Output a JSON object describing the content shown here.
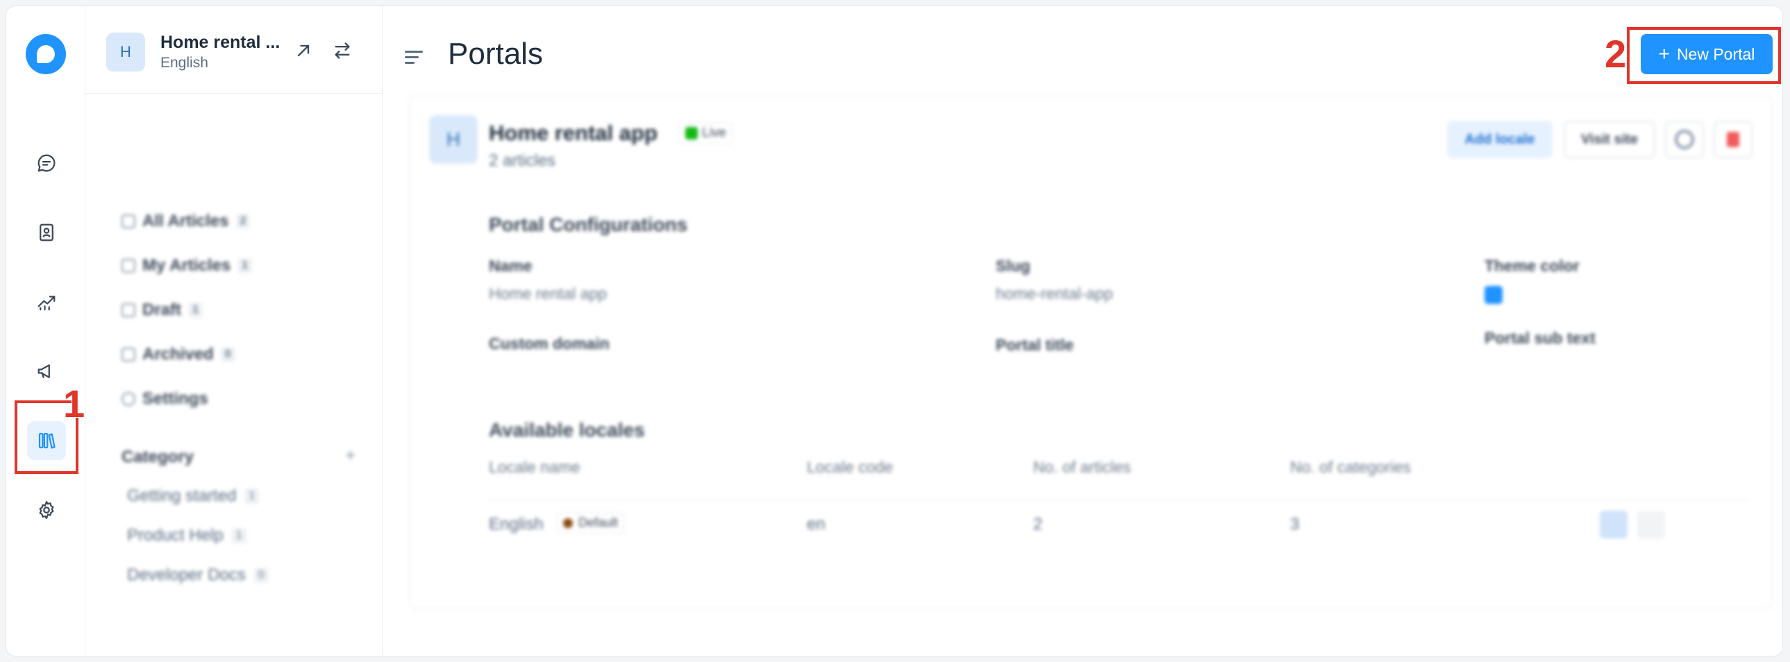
{
  "app": {
    "accent": "#1f93ff"
  },
  "rail": {
    "items": [
      {
        "name": "conversations",
        "icon": "chat-bubble-icon"
      },
      {
        "name": "contacts",
        "icon": "contact-card-icon"
      },
      {
        "name": "reports",
        "icon": "chart-line-icon"
      },
      {
        "name": "campaigns",
        "icon": "megaphone-icon"
      },
      {
        "name": "help-center",
        "icon": "library-books-icon",
        "active": true
      },
      {
        "name": "settings",
        "icon": "gear-icon"
      }
    ]
  },
  "portal": {
    "avatar": "H",
    "name": "Home rental ...",
    "locale": "English"
  },
  "sidebar": {
    "items": [
      {
        "label": "All Articles",
        "count": "2"
      },
      {
        "label": "My Articles",
        "count": "1"
      },
      {
        "label": "Draft",
        "count": "1"
      },
      {
        "label": "Archived",
        "count": "0"
      },
      {
        "label": "Settings"
      }
    ],
    "category_title": "Category",
    "category_add": "+",
    "categories": [
      {
        "label": "Getting started",
        "count": "1"
      },
      {
        "label": "Product Help",
        "count": "1"
      },
      {
        "label": "Developer Docs",
        "count": "0"
      }
    ]
  },
  "main": {
    "title": "Portals",
    "new_portal_label": "New Portal",
    "card": {
      "avatar": "H",
      "name": "Home rental app",
      "status": "Live",
      "article_count": "2 articles",
      "add_locale": "Add locale",
      "visit_site": "Visit site",
      "config_title": "Portal Configurations",
      "fields": {
        "name_label": "Name",
        "name_value": "Home rental app",
        "slug_label": "Slug",
        "slug_value": "home-rental-app",
        "theme_label": "Theme color",
        "theme_value": "#1f93ff",
        "domain_label": "Custom domain",
        "portal_title_label": "Portal title",
        "sub_text_label": "Portal sub text"
      },
      "locales_title": "Available locales",
      "locale_headers": [
        "Locale name",
        "Locale code",
        "No. of articles",
        "No. of categories"
      ],
      "locale_rows": [
        {
          "name": "English",
          "tag": "Default",
          "code": "en",
          "articles": "2",
          "categories": "3"
        }
      ]
    }
  },
  "annotations": [
    "1",
    "2"
  ]
}
